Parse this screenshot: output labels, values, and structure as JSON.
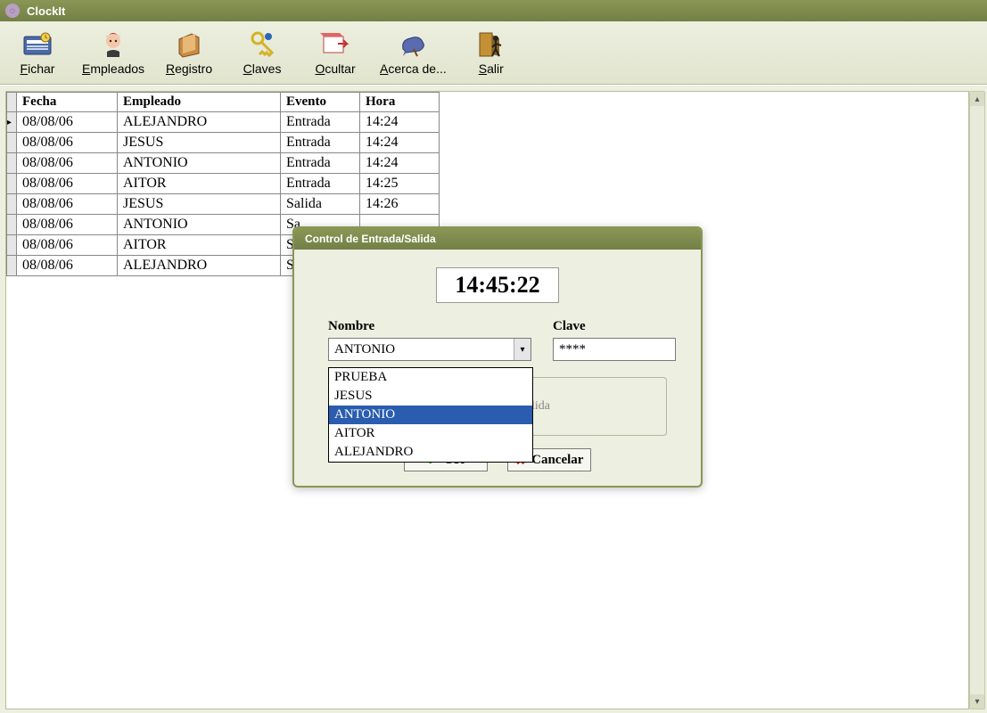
{
  "window": {
    "title": "ClockIt"
  },
  "toolbar": {
    "fichar": "Fichar",
    "empleados": "Empleados",
    "registro": "Registro",
    "claves": "Claves",
    "ocultar": "Ocultar",
    "acerca": "Acerca de...",
    "salir": "Salir"
  },
  "table": {
    "headers": {
      "fecha": "Fecha",
      "empleado": "Empleado",
      "evento": "Evento",
      "hora": "Hora"
    },
    "rows": [
      {
        "fecha": "08/08/06",
        "empleado": "ALEJANDRO",
        "evento": "Entrada",
        "hora": "14:24",
        "current": true
      },
      {
        "fecha": "08/08/06",
        "empleado": "JESUS",
        "evento": "Entrada",
        "hora": "14:24"
      },
      {
        "fecha": "08/08/06",
        "empleado": "ANTONIO",
        "evento": "Entrada",
        "hora": "14:24"
      },
      {
        "fecha": "08/08/06",
        "empleado": "AITOR",
        "evento": "Entrada",
        "hora": "14:25"
      },
      {
        "fecha": "08/08/06",
        "empleado": "JESUS",
        "evento": "Salida",
        "hora": "14:26"
      },
      {
        "fecha": "08/08/06",
        "empleado": "ANTONIO",
        "evento": "Sa",
        "hora": ""
      },
      {
        "fecha": "08/08/06",
        "empleado": "AITOR",
        "evento": "Sa",
        "hora": ""
      },
      {
        "fecha": "08/08/06",
        "empleado": "ALEJANDRO",
        "evento": "Sa",
        "hora": ""
      }
    ]
  },
  "dialog": {
    "title": "Control de Entrada/Salida",
    "clock": "14:45:22",
    "nombre_label": "Nombre",
    "clave_label": "Clave",
    "nombre_value": "ANTONIO",
    "clave_value": "****",
    "options": [
      "PRUEBA",
      "JESUS",
      "ANTONIO",
      "AITOR",
      "ALEJANDRO"
    ],
    "selected_option": "ANTONIO",
    "hidden_action_hint": "lida",
    "ok": "OK",
    "cancel": "Cancelar"
  }
}
